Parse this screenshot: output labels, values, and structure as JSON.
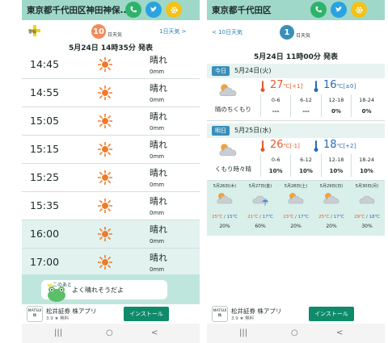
{
  "left": {
    "header_title": "東京都千代田区神田神保...",
    "badge": "警報",
    "day_number": "10",
    "day_unit": "日天気",
    "next_link": "1日天気 >",
    "issued": "5月24日 14時35分 発表",
    "hours": [
      {
        "time": "14:45",
        "weather": "晴れ",
        "rain": "0mm",
        "night": false
      },
      {
        "time": "14:55",
        "weather": "晴れ",
        "rain": "0mm",
        "night": false
      },
      {
        "time": "15:05",
        "weather": "晴れ",
        "rain": "0mm",
        "night": false
      },
      {
        "time": "15:15",
        "weather": "晴れ",
        "rain": "0mm",
        "night": false
      },
      {
        "time": "15:25",
        "weather": "晴れ",
        "rain": "0mm",
        "night": false
      },
      {
        "time": "15:35",
        "weather": "晴れ",
        "rain": "0mm",
        "night": false
      },
      {
        "time": "16:00",
        "weather": "晴れ",
        "rain": "0mm",
        "night": true
      },
      {
        "time": "17:00",
        "weather": "晴れ",
        "rain": "0mm",
        "night": true
      }
    ],
    "character_small": "このあと",
    "character_message": "よく晴れそうだよ"
  },
  "right": {
    "header_title": "東京都千代田区",
    "back_link": "< 10日天気",
    "day_number": "1",
    "day_unit": "日天気",
    "issued": "5月24日 11時00分 発表",
    "days": [
      {
        "tag": "今日",
        "date": "5月24日(火)",
        "max": "27",
        "max_diff": "[+1]",
        "min": "16",
        "min_diff": "[±0]",
        "condition": "晴のちくもり",
        "periods": [
          "0-6",
          "6-12",
          "12-18",
          "18-24"
        ],
        "rain": [
          "---",
          "---",
          "0%",
          "0%"
        ]
      },
      {
        "tag": "明日",
        "date": "5月25日(水)",
        "max": "26",
        "max_diff": "[-1]",
        "min": "18",
        "min_diff": "[+2]",
        "condition": "くもり時々晴",
        "periods": [
          "0-6",
          "6-12",
          "12-18",
          "18-24"
        ],
        "rain": [
          "10%",
          "10%",
          "10%",
          "10%"
        ]
      }
    ],
    "weekly": [
      {
        "date": "5月26日(木)",
        "hi": "25℃",
        "lo": "15℃",
        "pct": "20%",
        "icon": "cloud-sun"
      },
      {
        "date": "5月27日(金)",
        "hi": "21℃",
        "lo": "17℃",
        "pct": "60%",
        "icon": "umbrella-cloud"
      },
      {
        "date": "5月28日(土)",
        "hi": "23℃",
        "lo": "17℃",
        "pct": "20%",
        "icon": "sun-cloud"
      },
      {
        "date": "5月29日(日)",
        "hi": "25℃",
        "lo": "17℃",
        "pct": "20%",
        "icon": "sun-cloud"
      },
      {
        "date": "5月30日(月)",
        "hi": "29℃",
        "lo": "18℃",
        "pct": "30%",
        "icon": "cloud"
      }
    ]
  },
  "ad": {
    "logo": "MATSUI 株",
    "title": "松井証券 株アプリ",
    "rating": "3.9 ★ 無料",
    "button": "インストール"
  },
  "nav": {
    "recent": "|||",
    "home": "○",
    "back": "<"
  },
  "colors": {
    "header": "#9fd8c9",
    "hot": "#e65a2a",
    "cold": "#2a6ab0",
    "accent_circle_left": "#f28a5a",
    "accent_circle_right": "#3a8fb8",
    "install": "#0f8a6a"
  }
}
